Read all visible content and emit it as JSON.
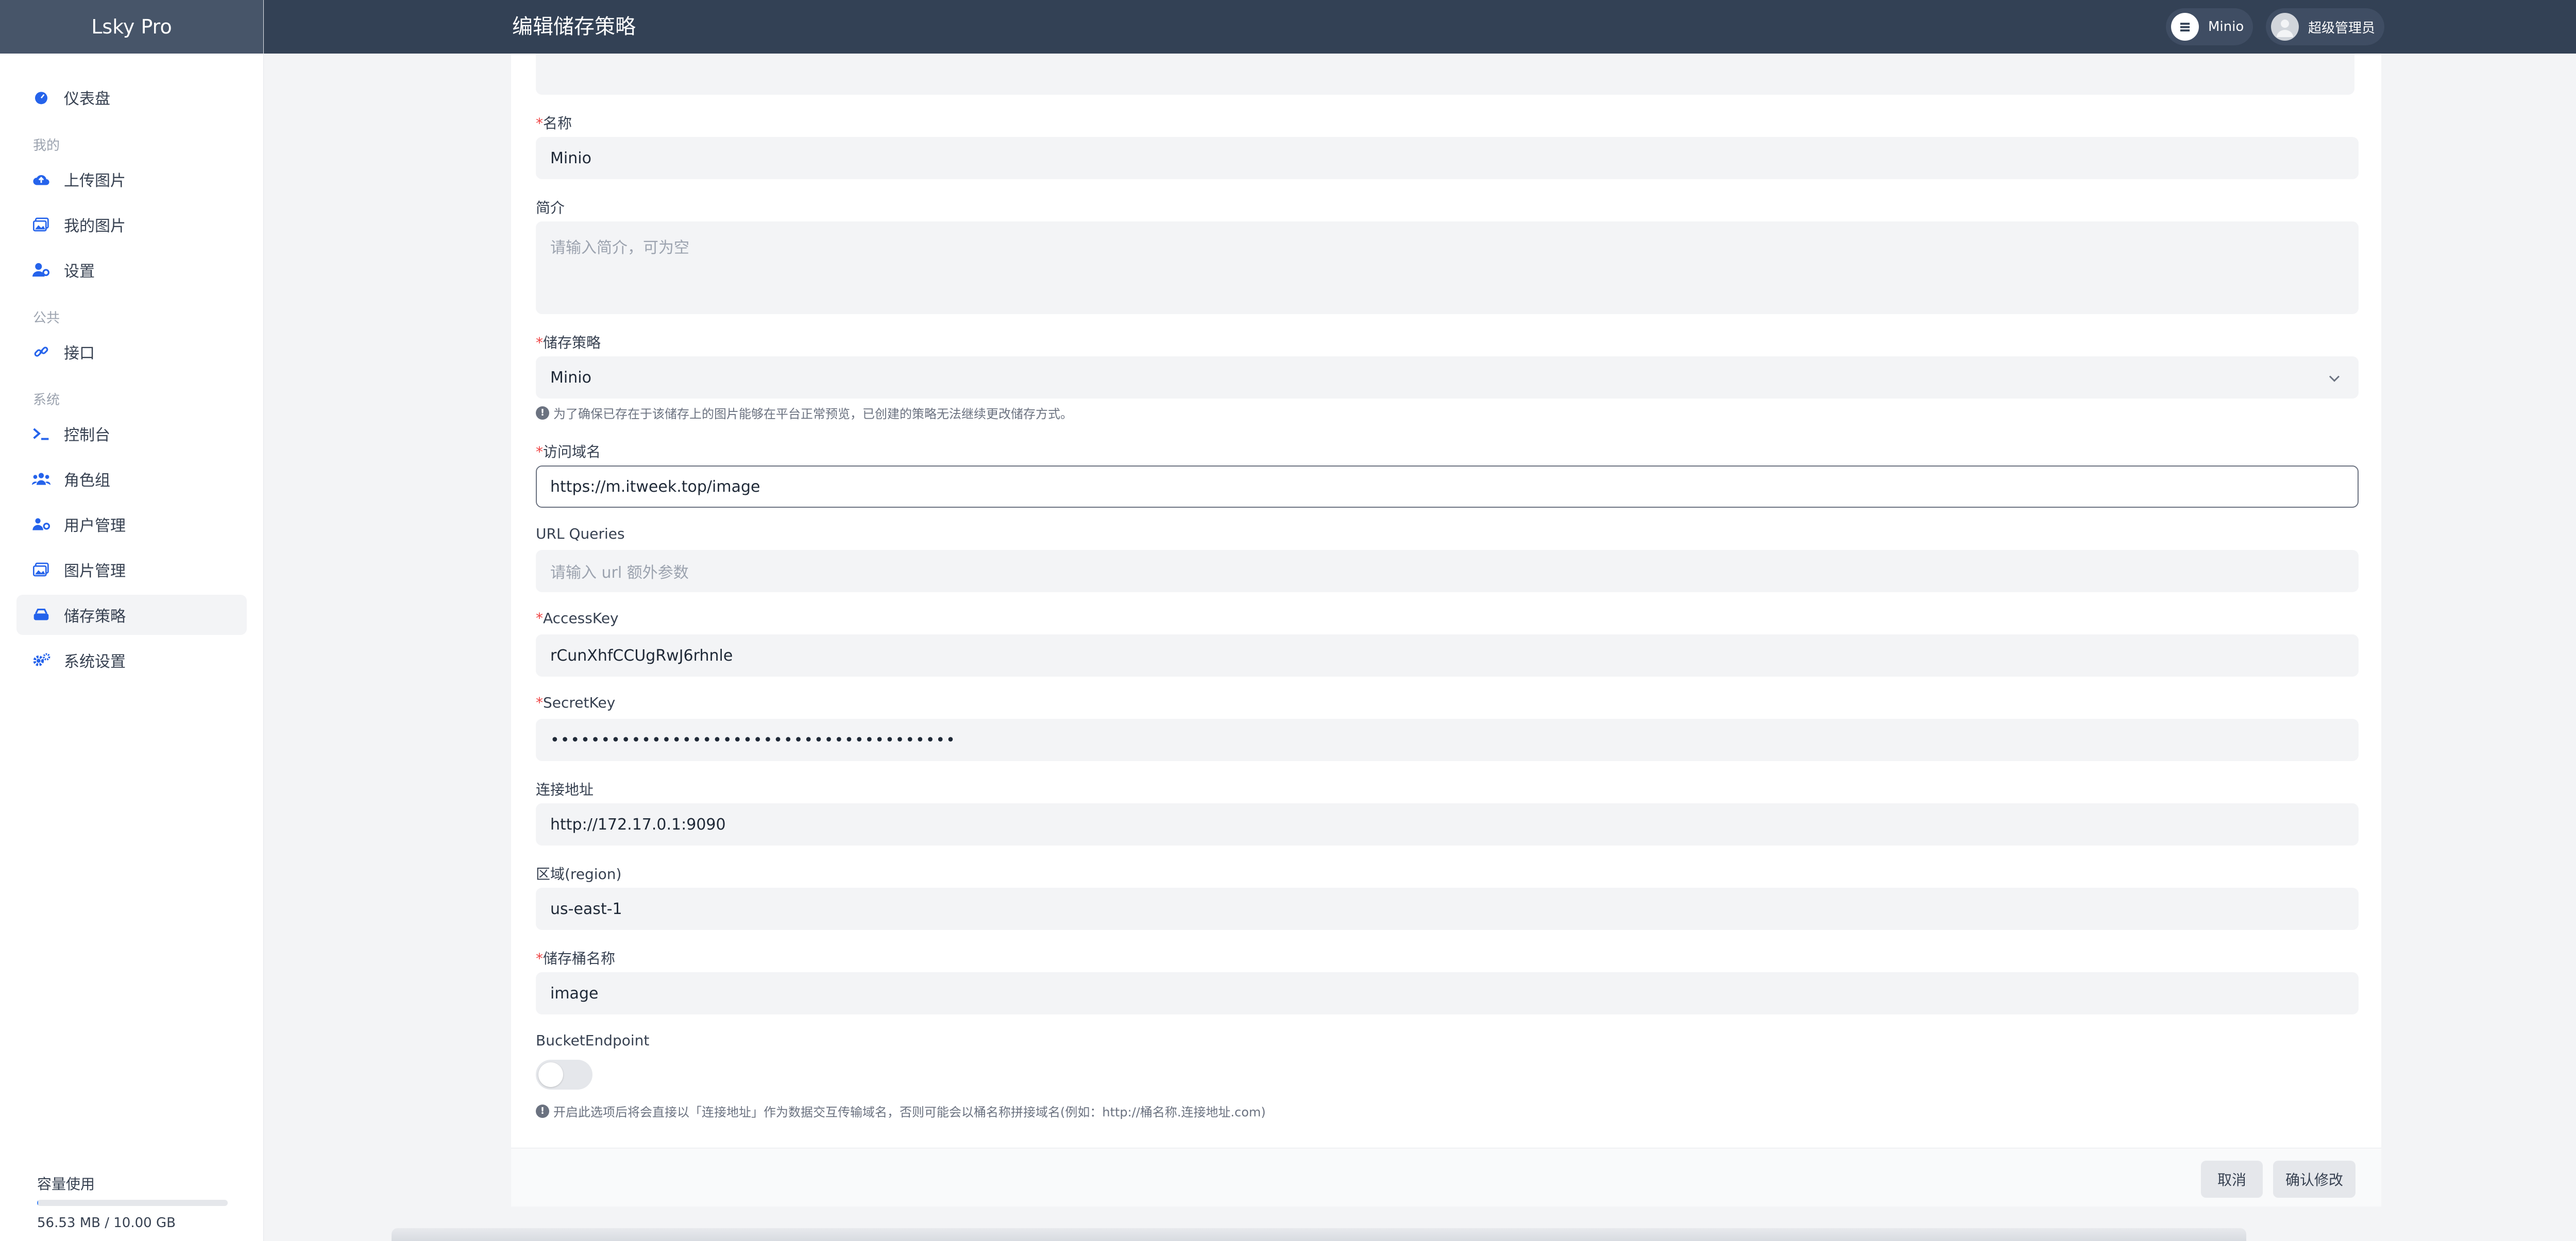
{
  "app": {
    "brand": "Lsky Pro",
    "page_title": "编辑储存策略"
  },
  "topbar": {
    "strategy_label": "Minio",
    "user_label": "超级管理员"
  },
  "sidebar": {
    "dashboard": "仪表盘",
    "group_mine": "我的",
    "upload": "上传图片",
    "my_images": "我的图片",
    "settings": "设置",
    "group_public": "公共",
    "api": "接口",
    "group_system": "系统",
    "console": "控制台",
    "roles": "角色组",
    "users": "用户管理",
    "images": "图片管理",
    "strategies": "储存策略",
    "system_settings": "系统设置"
  },
  "usage": {
    "label": "容量使用",
    "text": "56.53 MB / 10.00 GB",
    "fraction": 0.0055
  },
  "form": {
    "required_mark": "*",
    "name_label": "名称",
    "name_value": "Minio",
    "intro_label": "简介",
    "intro_placeholder": "请输入简介，可为空",
    "strategy_label": "储存策略",
    "strategy_value": "Minio",
    "strategy_hint": "为了确保已存在于该储存上的图片能够在平台正常预览，已创建的策略无法继续更改储存方式。",
    "domain_label": "访问域名",
    "domain_value": "https://m.itweek.top/image",
    "url_queries_label": "URL Queries",
    "url_queries_placeholder": "请输入 url 额外参数",
    "access_key_label": "AccessKey",
    "access_key_value": "rCunXhfCCUgRwJ6rhnle",
    "secret_key_label": "SecretKey",
    "secret_key_value": "••••••••••••••••••••••••••••••••••••••••",
    "endpoint_label": "连接地址",
    "endpoint_value": "http://172.17.0.1:9090",
    "region_label": "区域(region)",
    "region_value": "us-east-1",
    "bucket_label": "储存桶名称",
    "bucket_value": "image",
    "bucket_endpoint_label": "BucketEndpoint",
    "bucket_endpoint_hint": "开启此选项后将会直接以「连接地址」作为数据交互传输域名，否则可能会以桶名称拼接域名(例如：http://桶名称.连接地址.com)"
  },
  "buttons": {
    "cancel": "取消",
    "confirm": "确认修改"
  },
  "colors": {
    "accent": "#2563eb",
    "topbar": "#334155",
    "required": "#ef4444"
  }
}
